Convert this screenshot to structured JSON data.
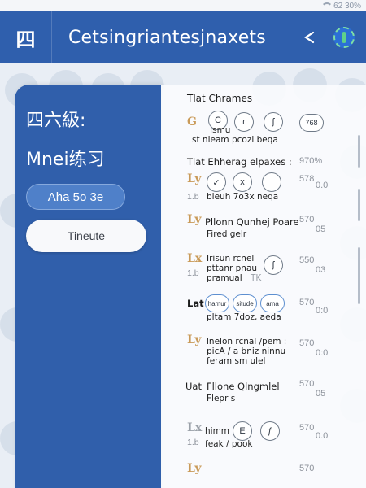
{
  "status": {
    "right": "62 30%"
  },
  "appbar": {
    "logo_glyph": "四",
    "title": "Cetsingriantesjnaxets"
  },
  "drawer": {
    "heading": "四六級:",
    "subheading": "Mnei练习",
    "chip_label": "Aha 5o 3e",
    "button_label": "Tineute"
  },
  "sheet": {
    "section1": {
      "title": "Tlat Chrames",
      "prefix": "G",
      "icons": [
        "C",
        "ɾ",
        "ʃ",
        "768"
      ],
      "line1": "Ismu",
      "line2": "st nieam pcozi beqa"
    },
    "section2": {
      "title": "Tlat Ehherag elpaxes :",
      "pct": "970%",
      "prefix": "Ly",
      "icons": [
        "✓",
        "x",
        ""
      ],
      "pct2": "578",
      "pct2_tail": "0.0",
      "lb": "1.b",
      "line": "bleuh 7o3x neqa"
    },
    "section3": {
      "prefix": "Ly",
      "title": "Pllonn Qunhej Poare",
      "sub": "Fired gelr",
      "pct": "570",
      "pct_tail": "05"
    },
    "section4": {
      "prefix": "Lx",
      "lb": "1.b",
      "line1": "Irisun rcnel",
      "line2": "pttanr pnau",
      "line3": "pramual",
      "line3_tail": "TK",
      "icon": "ʃ",
      "pct": "550",
      "pct_tail": "03"
    },
    "section5": {
      "prefix": "Lat",
      "icons": [
        "hamur",
        "situde",
        "ama"
      ],
      "line": "pltam 7doz, aeda",
      "pct": "570",
      "pct_tail": "0:0"
    },
    "section6": {
      "prefix": "Ly",
      "line1": "lnelon rcnal /pem :",
      "line2": "picA / a bniz ninnu",
      "line3": "feram sm ulel",
      "pct": "570",
      "pct_tail": "0:0"
    },
    "section7": {
      "prefix": "Uat",
      "title": "Fllone Qlngmlel",
      "sub": "Flepr s",
      "pct": "570",
      "pct_tail": "05"
    },
    "section8": {
      "prefix": "Lx",
      "lb": "1.b",
      "line1": "himm",
      "line2": "feak / pook",
      "icons": [
        "E",
        "ƒ"
      ],
      "pct": "570",
      "pct_tail": "0.0"
    },
    "section9": {
      "prefix": "Ly",
      "pct": "570"
    }
  }
}
